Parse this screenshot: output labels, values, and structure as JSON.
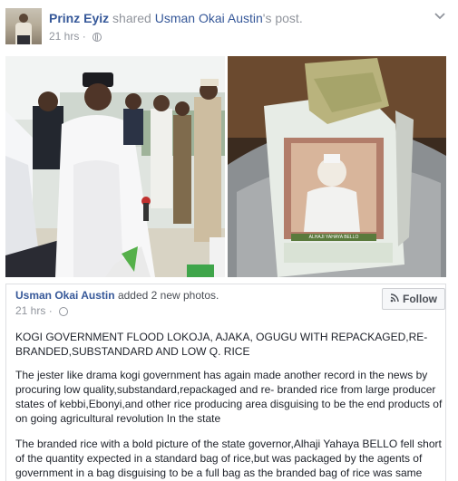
{
  "post": {
    "sharer": "Prinz Eyiz",
    "shared_text": "shared",
    "original_author_possessive": "Usman Okai Austin",
    "post_word": "'s post.",
    "time": "21 hrs",
    "privacy_icon": "globe-icon",
    "menu_icon": "chevron-down-icon"
  },
  "shared": {
    "author": "Usman Okai Austin",
    "action": "added 2 new photos.",
    "time": "21 hrs",
    "follow_label": "Follow",
    "follow_icon": "rss-icon",
    "headline": "KOGI GOVERNMENT FLOOD LOKOJA, AJAKA, OGUGU WITH REPACKAGED,RE-BRANDED,SUBSTANDARD AND LOW Q. RICE",
    "paragraph1": "The jester like drama kogi government has again made another record in the news by procuring low quality,substandard,repackaged and re- branded rice from large producer states of kebbi,Ebonyi,and other rice producing area disguising to be the end products of on going agricultural revolution In the state",
    "paragraph2": "The branded rice with a bold picture of the state governor,Alhaji Yahaya BELLO fell short of the quantity expected in a standard bag of rice,but was packaged by the agents of government in a bag disguising to be a full bag as the branded bag of rice was same"
  },
  "photos": {
    "bag_print": "ALHAJI YAHAYA BELLO"
  },
  "colors": {
    "link": "#365899",
    "meta": "#90949c",
    "text": "#1d2129",
    "border": "#dddfe2"
  }
}
